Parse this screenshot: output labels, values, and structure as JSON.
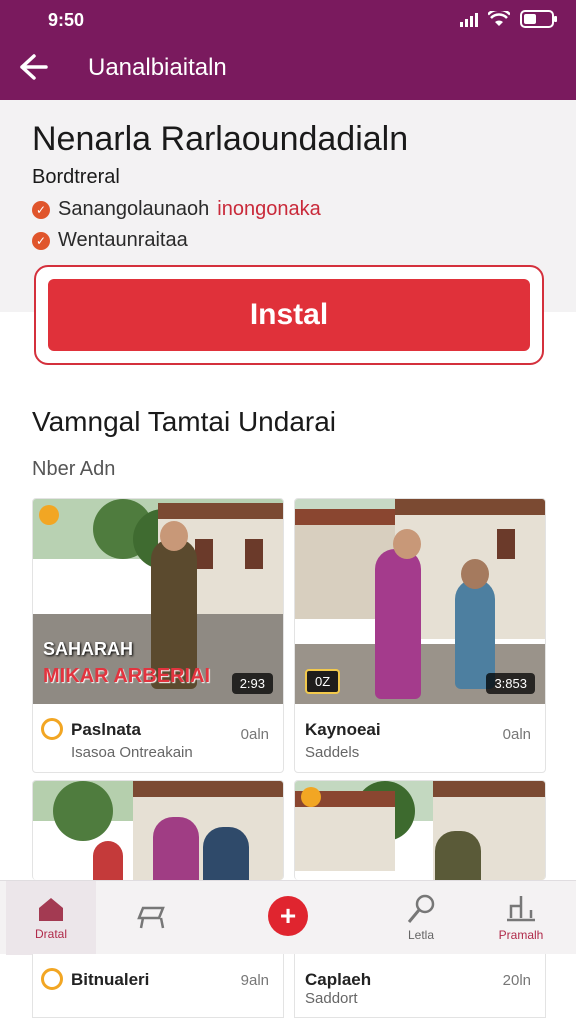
{
  "status": {
    "time": "9:50"
  },
  "header": {
    "title": "Uanalbiaitaln"
  },
  "hero": {
    "title": "Nenarla Rarlaoundadialn",
    "subtitle": "Bordtreral",
    "checks": [
      {
        "text": "Sanangolaunaoh",
        "accent": "inongonaka"
      },
      {
        "text": "Wentaunraitaa",
        "accent": ""
      }
    ],
    "install_label": "Instal"
  },
  "section": {
    "title": "Vamngal Tamtai Undarai",
    "subtitle": "Nber Adn"
  },
  "cards": [
    {
      "overlay_line1": "SAHARAH",
      "overlay_line2": "MIKAR ARBERIAI",
      "duration": "2:93",
      "title": "Paslnata",
      "sub": "Isasoa Ontreakain",
      "time": "0aln"
    },
    {
      "overlay_line1": "",
      "overlay_line2": "",
      "duration": "3:853",
      "badge": "0Z",
      "title": "Kaynoeai",
      "sub": "Saddels",
      "time": "0aln"
    },
    {
      "title": "Bitnualeri",
      "sub": "",
      "time": "9aln"
    },
    {
      "title": "Caplaeh",
      "sub": "Saddort",
      "time": "20ln"
    }
  ],
  "nav": {
    "items": [
      {
        "label": "Dratal"
      },
      {
        "label": ""
      },
      {
        "label": ""
      },
      {
        "label": "Letla"
      },
      {
        "label": "Pramalh"
      }
    ],
    "fab": "+"
  },
  "colors": {
    "brand": "#7a1a5e",
    "install": "#e0313a",
    "accent": "#c92a3a"
  }
}
